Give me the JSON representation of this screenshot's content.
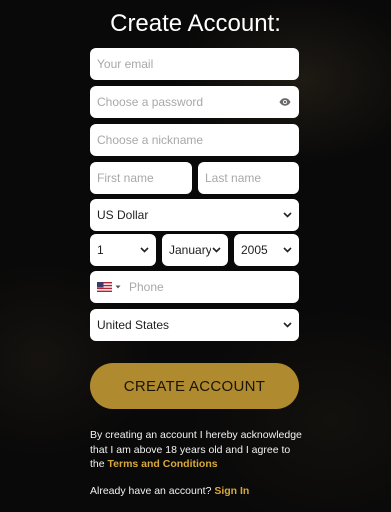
{
  "page": {
    "title": "Create Account:"
  },
  "form": {
    "email_placeholder": "Your email",
    "password_placeholder": "Choose a password",
    "nickname_placeholder": "Choose a nickname",
    "first_name_placeholder": "First name",
    "last_name_placeholder": "Last name",
    "currency_value": "US Dollar",
    "birth_day_value": "1",
    "birth_month_value": "January",
    "birth_year_value": "2005",
    "phone_placeholder": "Phone",
    "country_value": "United States",
    "phone_country_flag": "us-flag-icon"
  },
  "actions": {
    "create_account_label": "CREATE ACCOUNT"
  },
  "terms": {
    "text": "By creating an account I hereby acknowledge that I am above 18 years old and I agree to the ",
    "link_label": "Terms and Conditions"
  },
  "signin": {
    "prompt": "Already have an account?",
    "link_label": "Sign In"
  },
  "colors": {
    "background": "#090909",
    "accent_button": "#b08a2e",
    "link": "#d8a83a",
    "field_background": "#ffffff"
  }
}
